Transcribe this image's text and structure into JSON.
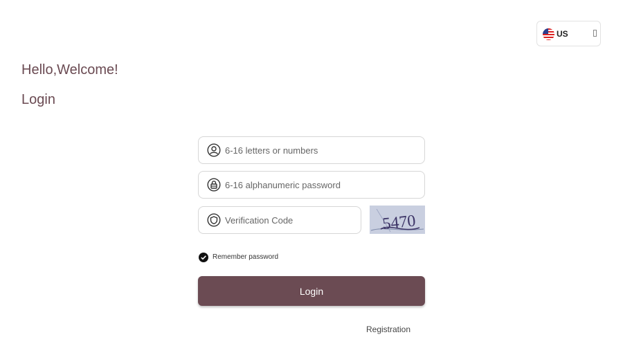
{
  "language": {
    "code": "US",
    "icon": "us-flag-icon"
  },
  "header": {
    "welcome": "Hello,Welcome!",
    "title": "Login"
  },
  "form": {
    "username_placeholder": "6-16 letters or numbers",
    "password_placeholder": "6-16 alphanumeric password",
    "code_placeholder": "Verification Code",
    "captcha_text": "5470",
    "remember_label": "Remember password",
    "remember_checked": true,
    "login_label": "Login",
    "register_label": "Registration"
  },
  "colors": {
    "brand": "#6b4b53",
    "heading": "#6a4a52",
    "captcha_bg": "#c9cfe0"
  }
}
